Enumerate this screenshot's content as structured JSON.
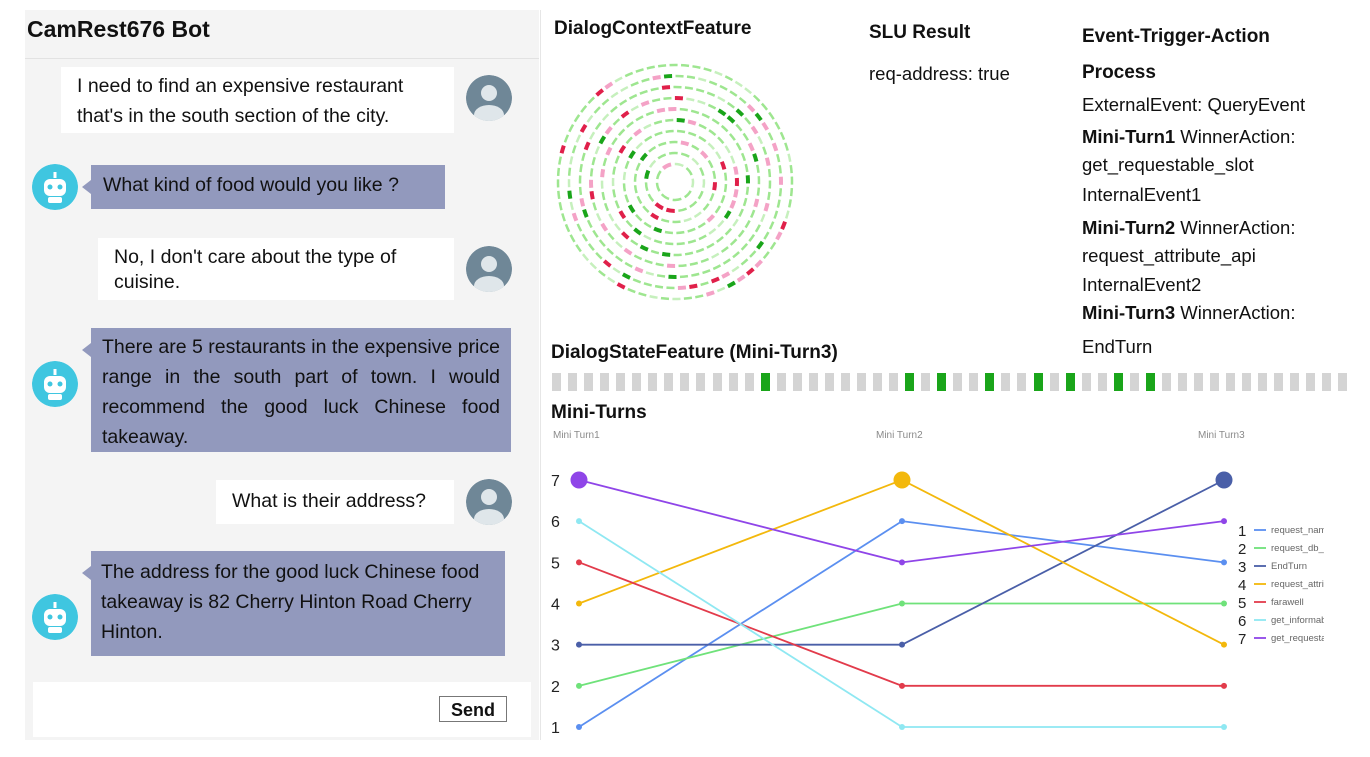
{
  "chat": {
    "title": "CamRest676 Bot",
    "messages": [
      {
        "role": "user",
        "text": "I need to find an expensive restaurant that's in the south section of the city."
      },
      {
        "role": "bot",
        "text": "What kind of food would you like ?"
      },
      {
        "role": "user",
        "text": "No, I don't care about the type of cuisine."
      },
      {
        "role": "bot",
        "text": "There are 5 restaurants in the expensive price range in the south part of town. I would recommend the good luck Chinese food takeaway."
      },
      {
        "role": "user",
        "text": "What is their address?"
      },
      {
        "role": "bot",
        "text": "The address for the good luck Chinese food takeaway is 82 Cherry Hinton Road Cherry Hinton."
      }
    ],
    "input_value": "",
    "send_label": "Send"
  },
  "context": {
    "title": "DialogContextFeature"
  },
  "slu": {
    "title": "SLU Result",
    "value": "req-address: true"
  },
  "eta": {
    "title": "Event-Trigger-Action Process",
    "lines": [
      {
        "bold": "",
        "text": "ExternalEvent: QueryEvent"
      },
      {
        "bold": "Mini-Turn1",
        "text": " WinnerAction:"
      },
      {
        "bold": "",
        "text": "get_requestable_slot"
      },
      {
        "bold": "",
        "text": "InternalEvent1"
      },
      {
        "bold": "Mini-Turn2",
        "text": " WinnerAction:"
      },
      {
        "bold": "",
        "text": "request_attribute_api"
      },
      {
        "bold": "",
        "text": "InternalEvent2"
      },
      {
        "bold": "Mini-Turn3",
        "text": " WinnerAction:"
      },
      {
        "bold": "",
        "text": "EndTurn"
      }
    ]
  },
  "state": {
    "title": "DialogStateFeature (Mini-Turn3)",
    "active_cells": [
      13,
      22,
      24,
      27,
      30,
      32,
      35,
      37
    ]
  },
  "minituns_title": "Mini-Turns",
  "chart_data": {
    "type": "line",
    "x": [
      "Mini Turn1",
      "Mini Turn2",
      "Mini Turn3"
    ],
    "ylim": [
      1,
      7
    ],
    "yticks": [
      1,
      2,
      3,
      4,
      5,
      6,
      7
    ],
    "series": [
      {
        "name": "request_name",
        "values": [
          1,
          6,
          5
        ],
        "color": "#5b8ff0"
      },
      {
        "name": "request_db_ru",
        "values": [
          2,
          4,
          4
        ],
        "color": "#6fe27a"
      },
      {
        "name": "EndTurn",
        "values": [
          3,
          3,
          7
        ],
        "color": "#4a5fa8"
      },
      {
        "name": "request_attribu",
        "values": [
          4,
          7,
          3
        ],
        "color": "#f3b80c"
      },
      {
        "name": "farawell",
        "values": [
          5,
          2,
          2
        ],
        "color": "#e23b4b"
      },
      {
        "name": "get_informable",
        "values": [
          6,
          1,
          1
        ],
        "color": "#8fe8f2"
      },
      {
        "name": "get_requestable",
        "values": [
          7,
          5,
          6
        ],
        "color": "#8f45e8"
      }
    ],
    "legend": [
      "1",
      "2",
      "3",
      "4",
      "5",
      "6",
      "7"
    ],
    "legend_placement": "right",
    "highlight_rank": 7
  }
}
